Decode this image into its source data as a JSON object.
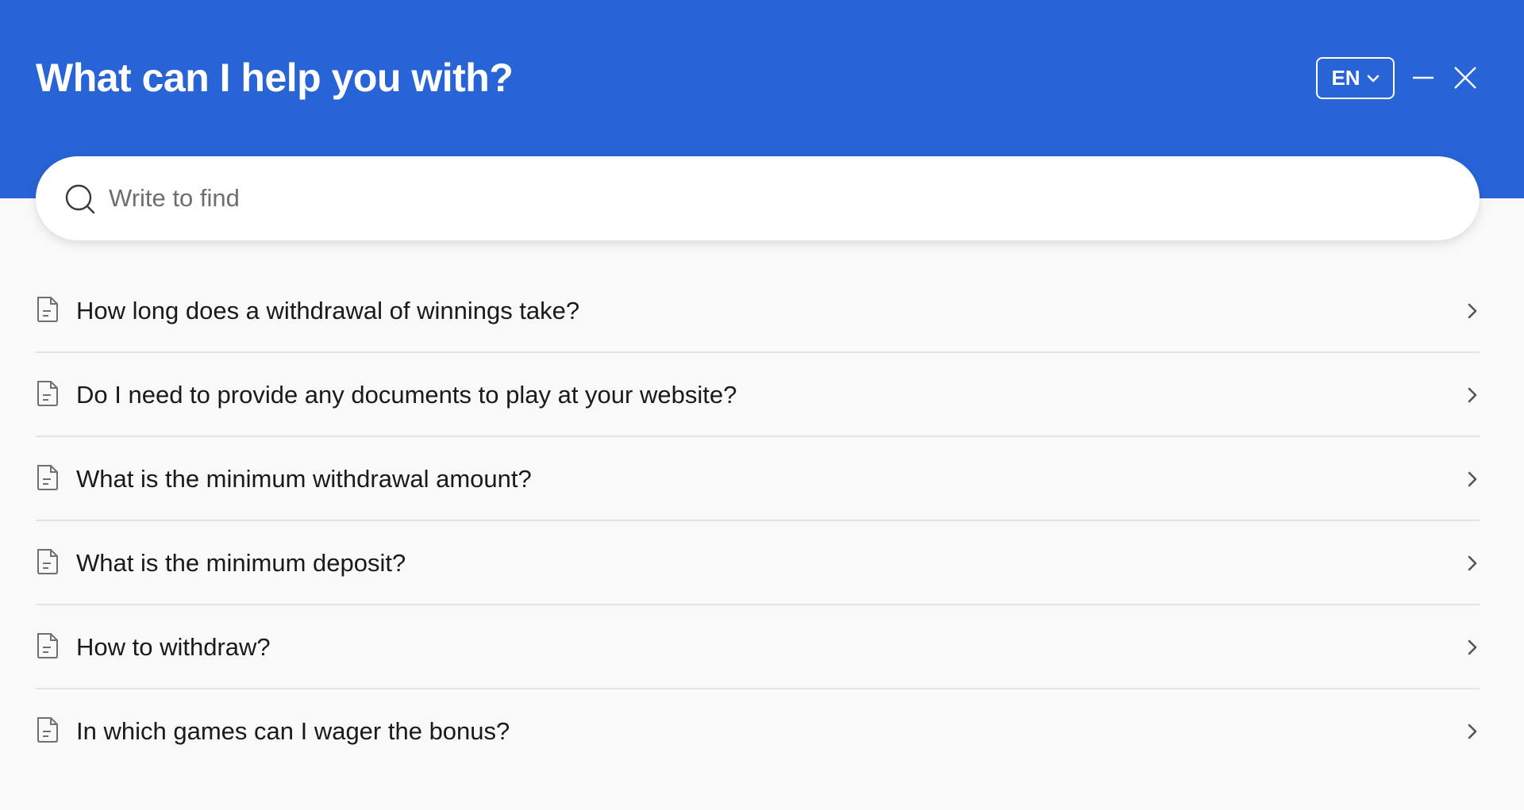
{
  "header": {
    "title": "What can I help you with?",
    "language_label": "EN",
    "background_color": "#2864d6"
  },
  "search": {
    "placeholder": "Write to find",
    "value": ""
  },
  "faq": {
    "items": [
      {
        "label": "How long does a withdrawal of winnings take?",
        "icon": "document-icon"
      },
      {
        "label": "Do I need to provide any documents to play at your website?",
        "icon": "document-icon"
      },
      {
        "label": "What is the minimum withdrawal amount?",
        "icon": "document-icon"
      },
      {
        "label": "What is the minimum deposit?",
        "icon": "document-icon"
      },
      {
        "label": "How to withdraw?",
        "icon": "document-icon"
      },
      {
        "label": "In which games can I wager the bonus?",
        "icon": "document-icon"
      }
    ]
  }
}
